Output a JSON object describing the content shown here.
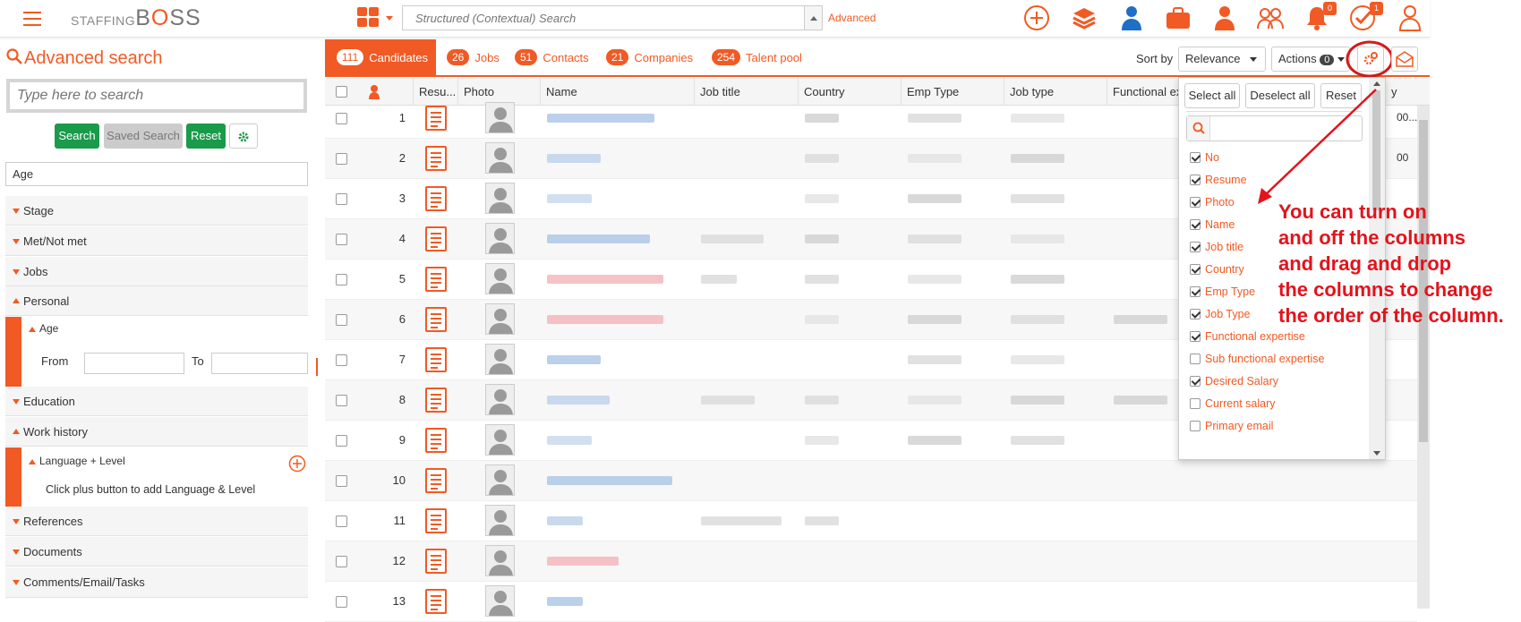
{
  "logo": {
    "prefix": "STAFFING",
    "brand_a": "B",
    "brand_o": "O",
    "brand_b": "SS"
  },
  "top_search": {
    "placeholder": "Structured (Contextual) Search",
    "advanced_label": "Advanced"
  },
  "top_icons": [
    {
      "name": "add-icon"
    },
    {
      "name": "stack-icon"
    },
    {
      "name": "candidate-icon"
    },
    {
      "name": "briefcase-icon"
    },
    {
      "name": "contact-icon"
    },
    {
      "name": "group-icon"
    },
    {
      "name": "bell-icon",
      "badge": "0"
    },
    {
      "name": "task-check-icon",
      "badge": "1"
    },
    {
      "name": "user-profile-icon"
    }
  ],
  "left": {
    "title": "Advanced search",
    "search_placeholder": "Type here to search",
    "search_btn": "Search",
    "saved_search_btn": "Saved Search",
    "reset_btn": "Reset",
    "filter_value": "Age",
    "sections": [
      "Stage",
      "Met/Not met",
      "Jobs",
      "Personal",
      "Education",
      "Work history",
      "References",
      "Documents",
      "Comments/Email/Tasks"
    ],
    "age_label": "Age",
    "from_label": "From",
    "to_label": "To",
    "lang_label": "Language + Level",
    "lang_hint": "Click plus button to add Language & Level"
  },
  "tabs": [
    {
      "count": "111",
      "label": "Candidates"
    },
    {
      "count": "26",
      "label": "Jobs"
    },
    {
      "count": "51",
      "label": "Contacts"
    },
    {
      "count": "21",
      "label": "Companies"
    },
    {
      "count": "254",
      "label": "Talent pool"
    }
  ],
  "sort_label": "Sort by",
  "sort_value": "Relevance",
  "actions_label": "Actions",
  "actions_count": "0",
  "columns": [
    "Resu...",
    "Photo",
    "Name",
    "Job title",
    "Country",
    "Emp Type",
    "Job type",
    "Functional ex",
    "y"
  ],
  "rows": [
    "1",
    "2",
    "3",
    "4",
    "5",
    "6",
    "7",
    "8",
    "9",
    "10",
    "11",
    "12",
    "13"
  ],
  "row1_extra": "00...",
  "row2_extra": "00",
  "menu": {
    "select_all": "Select all",
    "deselect_all": "Deselect all",
    "reset": "Reset",
    "options": [
      {
        "label": "No",
        "checked": true
      },
      {
        "label": "Resume",
        "checked": true
      },
      {
        "label": "Photo",
        "checked": true
      },
      {
        "label": "Name",
        "checked": true
      },
      {
        "label": "Job title",
        "checked": true
      },
      {
        "label": "Country",
        "checked": true
      },
      {
        "label": "Emp Type",
        "checked": true
      },
      {
        "label": "Job Type",
        "checked": true
      },
      {
        "label": "Functional expertise",
        "checked": true
      },
      {
        "label": "Sub functional expertise",
        "checked": false
      },
      {
        "label": "Desired Salary",
        "checked": true
      },
      {
        "label": "Current salary",
        "checked": false
      },
      {
        "label": "Primary email",
        "checked": false
      }
    ]
  },
  "annotation": [
    "You can turn on",
    "and off the columns",
    "and drag and drop",
    "the columns to change",
    "the order of the column."
  ],
  "colors": {
    "accent": "#f15a24",
    "green": "#1a9a4b",
    "annotation": "#e3131b"
  }
}
